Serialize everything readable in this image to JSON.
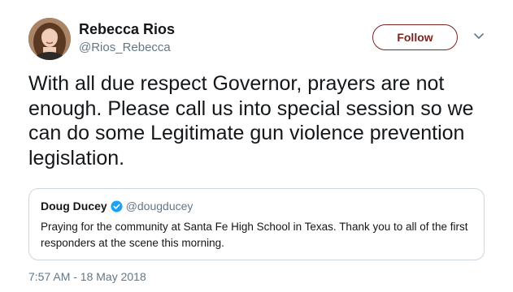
{
  "author": {
    "name": "Rebecca Rios",
    "handle": "@Rios_Rebecca"
  },
  "follow_label": "Follow",
  "tweet_text": "With all due respect Governor, prayers are not enough. Please call us into special session so we can do some Legitimate gun violence prevention legislation.",
  "quoted_tweet": {
    "name": "Doug Ducey",
    "handle": "@dougducey",
    "text": "Praying for the community at Santa Fe High School in Texas. Thank you to all of the first responders at the scene this morning."
  },
  "timestamp": "7:57 AM - 18 May 2018",
  "icons": {
    "menu": "chevron-down-icon",
    "verified": "verified-badge-icon"
  },
  "colors": {
    "follow_accent": "#7c2320",
    "secondary_text": "#657786",
    "border": "#ccd6dd",
    "verified": "#1da1f2"
  }
}
